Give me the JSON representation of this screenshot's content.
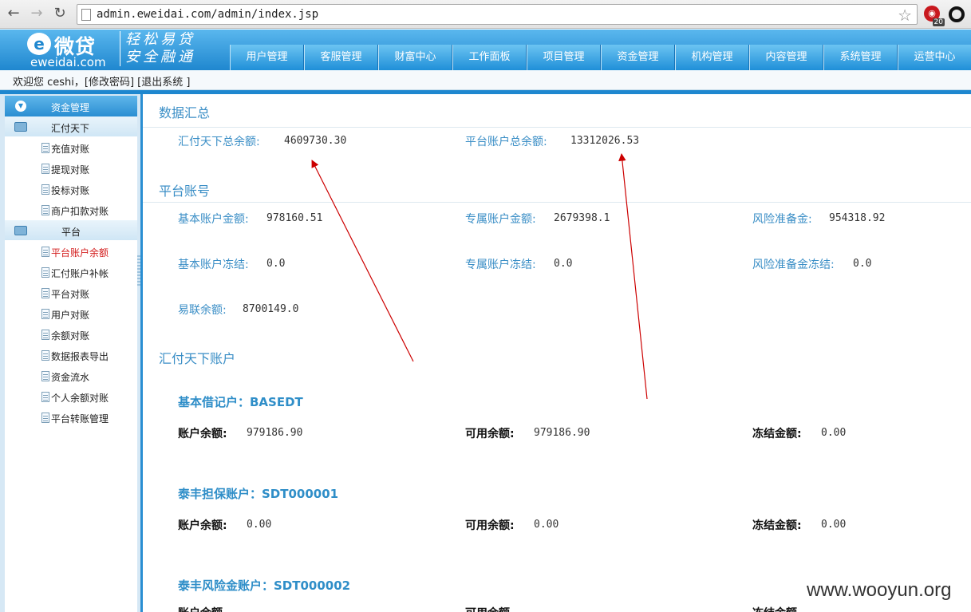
{
  "browser": {
    "url": "admin.eweidai.com/admin/index.jsp",
    "extension_count": "20"
  },
  "header": {
    "logo_cn": "微贷",
    "logo_en": "eweidai.com",
    "slogan_line1": "轻松易贷",
    "slogan_line2": "安全融通",
    "menu": [
      "用户管理",
      "客服管理",
      "财富中心",
      "工作面板",
      "项目管理",
      "资金管理",
      "机构管理",
      "内容管理",
      "系统管理",
      "运营中心"
    ]
  },
  "welcome": {
    "text": "欢迎您 ceshi，[修改密码] [退出系统 ]"
  },
  "sidebar": {
    "header": "资金管理",
    "groups": [
      {
        "label": "汇付天下",
        "items": [
          "充值对账",
          "提现对账",
          "投标对账",
          "商户扣款对账"
        ]
      },
      {
        "label": "平台",
        "items": [
          "平台账户余额",
          "汇付账户补帐",
          "平台对账",
          "用户对账",
          "余额对账",
          "数据报表导出",
          "资金流水",
          "个人余额对账",
          "平台转账管理"
        ]
      }
    ],
    "active_item": "平台账户余额"
  },
  "summary": {
    "title": "数据汇总",
    "chinapnr_total_label": "汇付天下总余额:",
    "chinapnr_total_value": "4609730.30",
    "platform_total_label": "平台账户总余额:",
    "platform_total_value": "13312026.53"
  },
  "platform": {
    "title": "平台账号",
    "basic_amount_label": "基本账户金额:",
    "basic_amount_value": "978160.51",
    "dedicated_amount_label": "专属账户金额:",
    "dedicated_amount_value": "2679398.1",
    "risk_reserve_label": "风险准备金:",
    "risk_reserve_value": "954318.92",
    "basic_frozen_label": "基本账户冻结:",
    "basic_frozen_value": "0.0",
    "dedicated_frozen_label": "专属账户冻结:",
    "dedicated_frozen_value": "0.0",
    "risk_frozen_label": "风险准备金冻结:",
    "risk_frozen_value": "0.0",
    "yilian_label": "易联余额:",
    "yilian_value": "8700149.0"
  },
  "chinapnr": {
    "title": "汇付天下账户",
    "accounts": [
      {
        "title": "基本借记户：BASEDT",
        "balance_label": "账户余额:",
        "balance": "979186.90",
        "available_label": "可用余额:",
        "available": "979186.90",
        "frozen_label": "冻结金额:",
        "frozen": "0.00"
      },
      {
        "title": "泰丰担保账户：SDT000001",
        "balance_label": "账户余额:",
        "balance": "0.00",
        "available_label": "可用余额:",
        "available": "0.00",
        "frozen_label": "冻结金额:",
        "frozen": "0.00"
      },
      {
        "title": "泰丰风险金账户：SDT000002",
        "balance_label": "账户余额",
        "available_label": "可用余额",
        "frozen_label": "冻结金额"
      }
    ]
  },
  "watermark": "www.wooyun.org",
  "colors": {
    "accent": "#1e87cf",
    "label_blue": "#3a8ec6",
    "annotation_red": "#cc0000"
  }
}
